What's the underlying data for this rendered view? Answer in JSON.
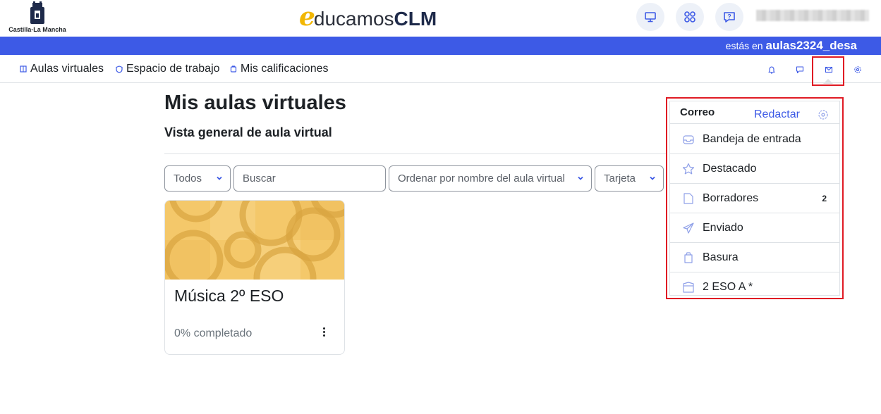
{
  "header": {
    "region_caption": "Castilla-La Mancha",
    "brand_e": "e",
    "brand_ducamos": "ducamos",
    "brand_clm": "CLM"
  },
  "site_bar": {
    "prefix": "estás en ",
    "site_name": "aulas2324_desa"
  },
  "nav": {
    "items": [
      {
        "label": "Aulas virtuales"
      },
      {
        "label": "Espacio de trabajo"
      },
      {
        "label": "Mis calificaciones"
      }
    ]
  },
  "main": {
    "page_title": "Mis aulas virtuales",
    "section_title": "Vista general de aula virtual",
    "filters": {
      "grouping": "Todos",
      "search_placeholder": "Buscar",
      "sort": "Ordenar por nombre del aula virtual",
      "view": "Tarjeta"
    },
    "courses": [
      {
        "title": "Música 2º ESO",
        "progress": "0% completado"
      }
    ]
  },
  "mail": {
    "title": "Correo",
    "compose": "Redactar",
    "folders": [
      {
        "label": "Bandeja de entrada",
        "count": "",
        "icon": "inbox-icon"
      },
      {
        "label": "Destacado",
        "count": "",
        "icon": "star-icon"
      },
      {
        "label": "Borradores",
        "count": "2",
        "icon": "draft-icon"
      },
      {
        "label": "Enviado",
        "count": "",
        "icon": "sent-icon"
      },
      {
        "label": "Basura",
        "count": "",
        "icon": "trash-icon"
      },
      {
        "label": "2 ESO A *",
        "count": "",
        "icon": "course-icon"
      }
    ]
  },
  "colors": {
    "accent": "#3d5ae6",
    "highlight": "#e01b24",
    "brand_yellow": "#f2b705"
  }
}
